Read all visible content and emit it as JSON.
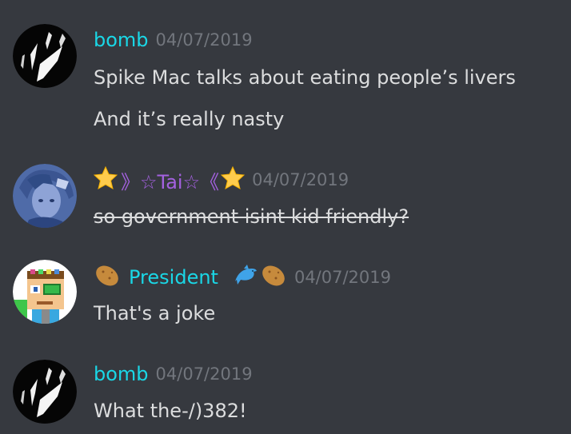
{
  "colors": {
    "background": "#36393f",
    "text": "#dcddde",
    "timestamp": "#72767d",
    "bomb": "#1ad7e6",
    "tai": "#a461e0",
    "president": "#1ad7e6"
  },
  "messages": [
    {
      "username": "bomb",
      "timestamp": "04/07/2019",
      "lines": [
        "Spike Mac talks about eating people’s livers",
        "And it’s really nasty"
      ]
    },
    {
      "username_prefix_icons": [
        "star-emoji"
      ],
      "username_text": "》☆Tai☆《",
      "username_suffix_icons": [
        "star-emoji"
      ],
      "timestamp": "04/07/2019",
      "lines": [
        "so government isint kid friendly?"
      ]
    },
    {
      "username_prefix_icons": [
        "potato-emoji"
      ],
      "username": "President",
      "username_suffix_icons": [
        "dolphin-emoji",
        "potato-emoji"
      ],
      "timestamp": "04/07/2019",
      "lines": [
        "That's a joke"
      ]
    },
    {
      "username": "bomb",
      "timestamp": "04/07/2019",
      "lines": [
        "What the-/)382!"
      ]
    }
  ]
}
